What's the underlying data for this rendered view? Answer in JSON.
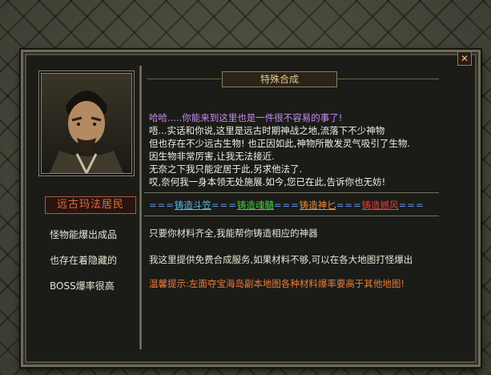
{
  "dialog": {
    "title": "特殊合成",
    "close_label": "✕"
  },
  "npc": {
    "name": "远古玛法居民",
    "info": [
      "怪物能爆出成品",
      "也存在着隐藏的",
      "BOSS爆率很高"
    ]
  },
  "story": [
    {
      "text": "哈哈.....你能来到这里也是一件很不容易的事了!",
      "color": "#c58cf0"
    },
    {
      "text": "唔...实话和你说,这里是远古时期神战之地,流落下不少神物",
      "color": "#f1eee6"
    },
    {
      "text": "但也存在不少远古生物! 也正因如此,神物所散发灵气吸引了生物.",
      "color": "#f1eee6"
    },
    {
      "text": "因生物非常厉害,让我无法接近.",
      "color": "#f1eee6"
    },
    {
      "text": "无奈之下我只能定居于此,另求他法了.",
      "color": "#f1eee6"
    },
    {
      "text": "哎,奈何我一身本领无处施展.如今,您已在此,告诉你也无妨!",
      "color": "#f1eee6"
    }
  ],
  "crafts": [
    {
      "label": "铸造斗笠",
      "color": "#5fb8e8"
    },
    {
      "label": "铸造魂髓",
      "color": "#3cd43c"
    },
    {
      "label": "铸造神匕",
      "color": "#ee8c3c"
    },
    {
      "label": "铸造撼风",
      "color": "#ee3c3c"
    }
  ],
  "crafts_separator": "===",
  "messages": [
    {
      "text": "只要你材料齐全,我能帮你铸造相应的神器",
      "color": "#e8e2d4"
    },
    {
      "text": "我这里提供免费合成服务,如果材料不够,可以在各大地图打怪爆出",
      "color": "#e8e2d4"
    },
    {
      "text": "温馨提示:左面夺宝海岛副本地图各种材料爆率要高于其他地图!",
      "color": "#ee7a3a"
    }
  ]
}
